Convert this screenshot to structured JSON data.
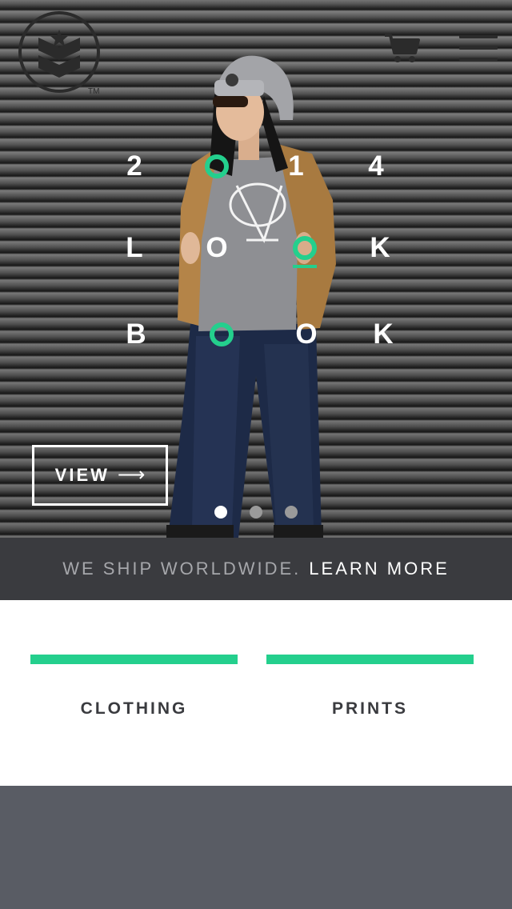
{
  "hero": {
    "slides_total": 3,
    "active_slide": 1,
    "lookbook_rows": [
      [
        "2",
        "O",
        "1",
        "4"
      ],
      [
        "L",
        "O",
        "O",
        "K"
      ],
      [
        "B",
        "O",
        "O",
        "K"
      ]
    ],
    "view_label": "VIEW",
    "view_arrow": "⟶",
    "dot_active_color": "#ffffff",
    "dot_inactive_color": "#9a9a9a"
  },
  "header": {
    "logo_icon": "chevron-shield-logo-icon",
    "logo_mark": "TM",
    "cart_icon": "cart-icon",
    "menu_icon": "hamburger-menu-icon"
  },
  "ship_bar": {
    "text": "WE SHIP WORLDWIDE.",
    "link": "LEARN MORE"
  },
  "categories": [
    {
      "label": "CLOTHING"
    },
    {
      "label": "PRINTS"
    }
  ],
  "colors": {
    "accent": "#24cf8d",
    "dark_bar": "#3a3b3f",
    "footer": "#595c64"
  }
}
